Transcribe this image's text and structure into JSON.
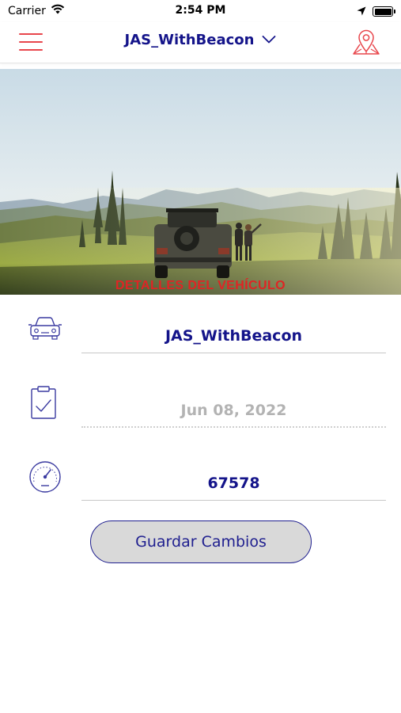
{
  "status_bar": {
    "carrier": "Carrier",
    "time": "2:54 PM"
  },
  "nav": {
    "title": "JAS_WithBeacon",
    "icons": {
      "menu": "hamburger-menu-icon",
      "dropdown": "chevron-down-icon",
      "map": "map-pin-icon"
    }
  },
  "hero": {
    "caption": "DETALLES DEL VEHÍCULO"
  },
  "form": {
    "vehicle_name": "JAS_WithBeacon",
    "date": "Jun 08, 2022",
    "odometer": "67578",
    "icons": {
      "vehicle": "car-icon",
      "date": "clipboard-check-icon",
      "odometer": "speedometer-icon"
    }
  },
  "actions": {
    "save_label": "Guardar Cambios"
  },
  "colors": {
    "accent_red": "#e8464c",
    "primary_navy": "#14148a",
    "caption_red": "#e02424",
    "button_fill": "#d9d9d9"
  }
}
